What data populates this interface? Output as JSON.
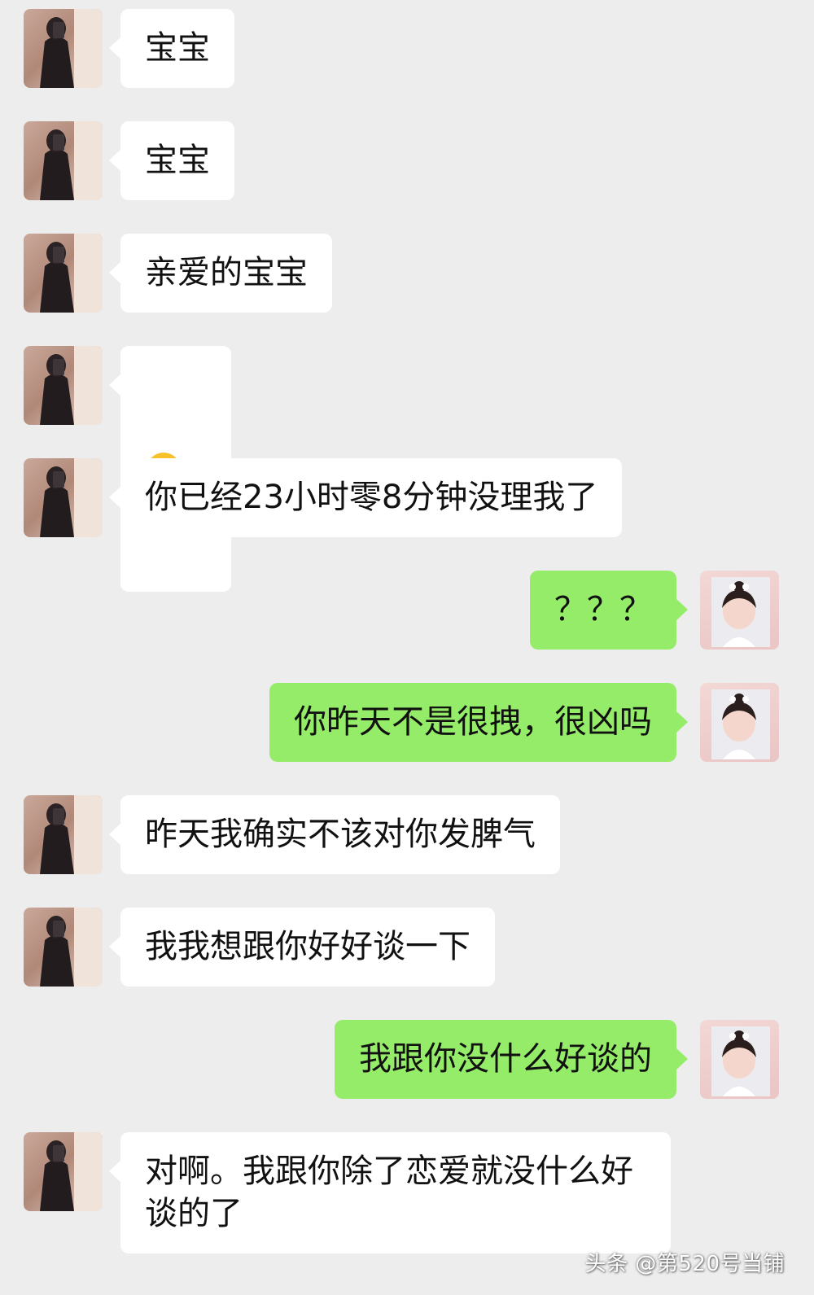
{
  "conversation": {
    "messages": [
      {
        "side": "in",
        "text": "宝宝"
      },
      {
        "side": "in",
        "text": "宝宝"
      },
      {
        "side": "in",
        "text": "亲爱的宝宝"
      },
      {
        "side": "in",
        "text": "",
        "emoji": "crying-face-emoji"
      },
      {
        "side": "in",
        "text": "你已经23小时零8分钟没理我了"
      },
      {
        "side": "out",
        "text": "？？？"
      },
      {
        "side": "out",
        "text": "你昨天不是很拽，很凶吗"
      },
      {
        "side": "in",
        "text": "昨天我确实不该对你发脾气"
      },
      {
        "side": "in",
        "text": "我我想跟你好好谈一下"
      },
      {
        "side": "out",
        "text": "我跟你没什么好谈的"
      },
      {
        "side": "in",
        "text": "对啊。我跟你除了恋爱就没什么好\n谈的了"
      }
    ]
  },
  "watermark": {
    "text": "头条 @第520号当铺"
  },
  "colors": {
    "background": "#ededed",
    "incoming_bubble": "#ffffff",
    "outgoing_bubble": "#95ec69",
    "emoji_face": "#f7c12a"
  }
}
